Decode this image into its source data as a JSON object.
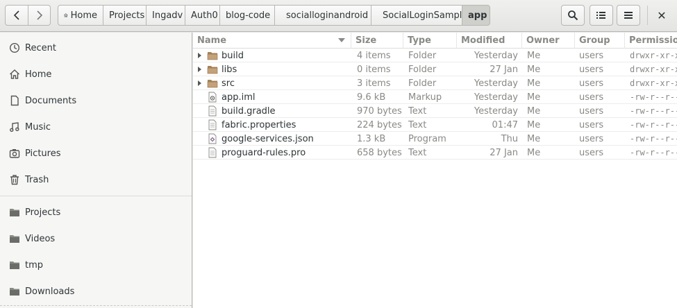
{
  "header": {
    "back_icon": "go-back-icon",
    "forward_icon": "go-forward-icon",
    "breadcrumbs": [
      {
        "label": "Home",
        "icon": "home-icon"
      },
      {
        "label": "Projects"
      },
      {
        "label": "Ingadv"
      },
      {
        "label": "Auth0"
      },
      {
        "label": "blog-code"
      },
      {
        "label": "socialloginandroid"
      },
      {
        "label": "SocialLoginSample"
      },
      {
        "label": "app"
      }
    ],
    "search_icon": "search-icon",
    "view_list_icon": "list-view-icon",
    "menu_icon": "menu-icon",
    "close_glyph": "✕"
  },
  "sidebar": {
    "items": [
      {
        "label": "Recent",
        "icon": "clock-icon"
      },
      {
        "label": "Home",
        "icon": "home-icon"
      },
      {
        "label": "Documents",
        "icon": "document-icon"
      },
      {
        "label": "Music",
        "icon": "music-icon"
      },
      {
        "label": "Pictures",
        "icon": "camera-icon"
      },
      {
        "label": "Trash",
        "icon": "trash-icon"
      },
      {
        "label": "Projects",
        "icon": "folder-icon"
      },
      {
        "label": "Videos",
        "icon": "folder-icon"
      },
      {
        "label": "tmp",
        "icon": "folder-icon"
      },
      {
        "label": "Downloads",
        "icon": "folder-icon"
      }
    ]
  },
  "files": {
    "columns": [
      "Name",
      "Size",
      "Type",
      "Modified",
      "Owner",
      "Group",
      "Permissions"
    ],
    "rows": [
      {
        "name": "build",
        "size": "4 items",
        "type": "Folder",
        "modified": "Yesterday",
        "owner": "Me",
        "group": "users",
        "perm": "drwxr-xr-x",
        "kind": "folder"
      },
      {
        "name": "libs",
        "size": "0 items",
        "type": "Folder",
        "modified": "27 Jan",
        "owner": "Me",
        "group": "users",
        "perm": "drwxr-xr-x",
        "kind": "folder"
      },
      {
        "name": "src",
        "size": "3 items",
        "type": "Folder",
        "modified": "Yesterday",
        "owner": "Me",
        "group": "users",
        "perm": "drwxr-xr-x",
        "kind": "folder"
      },
      {
        "name": "app.iml",
        "size": "9.6 kB",
        "type": "Markup",
        "modified": "Yesterday",
        "owner": "Me",
        "group": "users",
        "perm": "-rw-r--r--",
        "kind": "markup"
      },
      {
        "name": "build.gradle",
        "size": "970 bytes",
        "type": "Text",
        "modified": "Yesterday",
        "owner": "Me",
        "group": "users",
        "perm": "-rw-r--r--",
        "kind": "text"
      },
      {
        "name": "fabric.properties",
        "size": "224 bytes",
        "type": "Text",
        "modified": "01:47",
        "owner": "Me",
        "group": "users",
        "perm": "-rw-r--r--",
        "kind": "text"
      },
      {
        "name": "google-services.json",
        "size": "1.3 kB",
        "type": "Program",
        "modified": "Thu",
        "owner": "Me",
        "group": "users",
        "perm": "-rw-r--r--",
        "kind": "program"
      },
      {
        "name": "proguard-rules.pro",
        "size": "658 bytes",
        "type": "Text",
        "modified": "27 Jan",
        "owner": "Me",
        "group": "users",
        "perm": "-rw-r--r--",
        "kind": "text"
      }
    ]
  },
  "colors": {
    "folder": "#c4a178",
    "accent": "#888a85"
  }
}
